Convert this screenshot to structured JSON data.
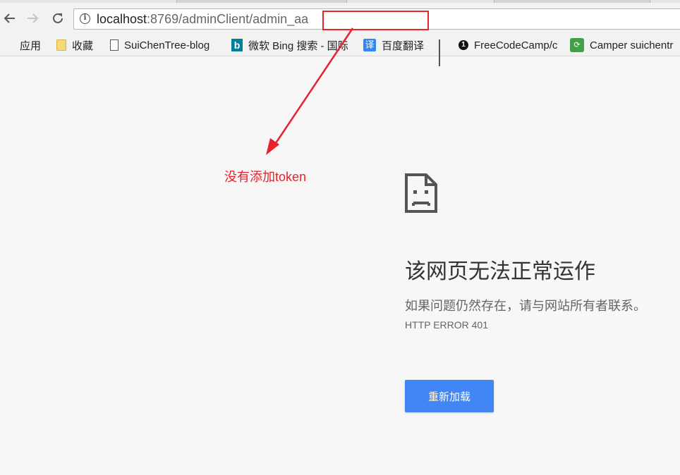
{
  "browser": {
    "url_host": "localhost",
    "url_rest": ":8769/adminClient/admin_aa"
  },
  "bookmarks": [
    {
      "label": "应用",
      "icon": "apps-grid-icon"
    },
    {
      "label": "收藏",
      "icon": "folder-icon"
    },
    {
      "label": "SuiChenTree-blog",
      "icon": "page-icon"
    },
    {
      "label": "微软 Bing 搜索 - 国际",
      "icon": "bing-icon"
    },
    {
      "label": "百度翻译",
      "icon": "baidu-translate-icon"
    },
    {
      "label": "",
      "icon": "bars-icon"
    },
    {
      "label": "FreeCodeCamp/c",
      "icon": "freecodecamp-icon"
    },
    {
      "label": "Camper suichentr",
      "icon": "camper-icon"
    }
  ],
  "annotation": {
    "text_cn": "没有添加",
    "text_token": "token",
    "color": "#e8212b"
  },
  "error": {
    "title": "该网页无法正常运作",
    "description": "如果问题仍然存在，请与网站所有者联系。",
    "code": "HTTP ERROR 401",
    "reload_label": "重新加载",
    "button_color": "#4285f4"
  }
}
